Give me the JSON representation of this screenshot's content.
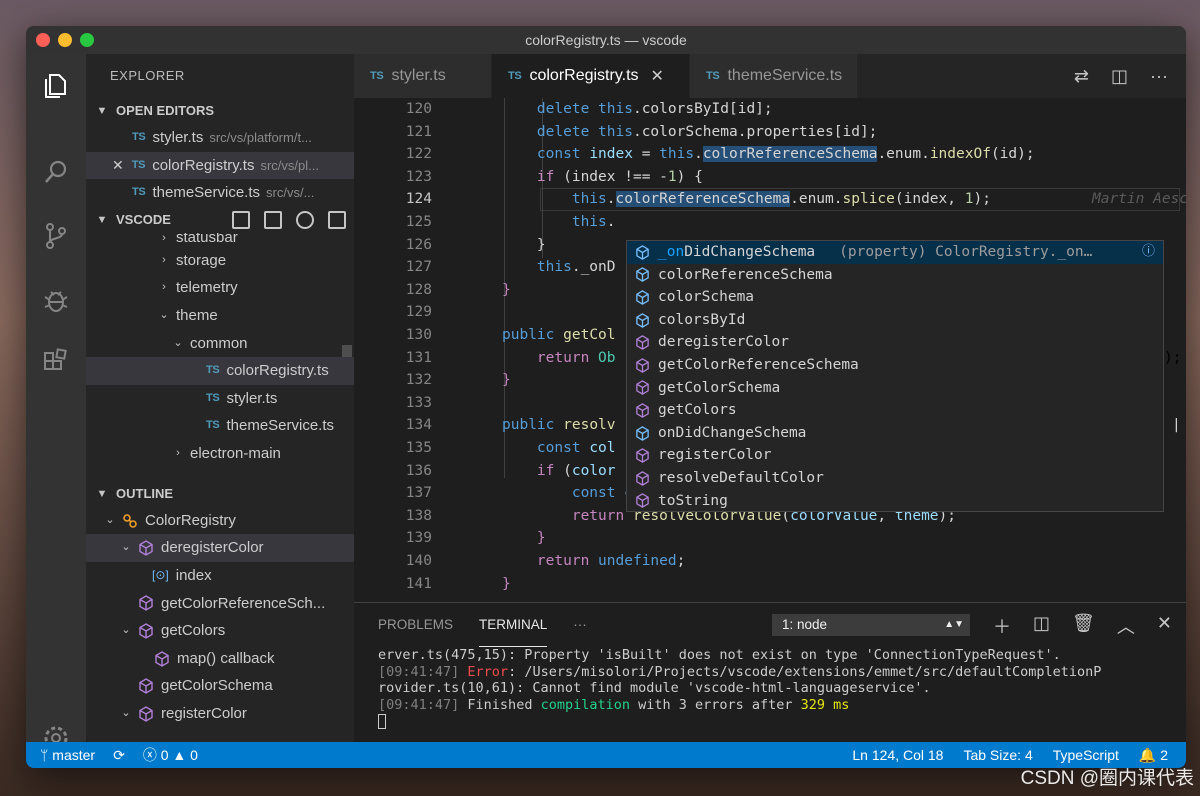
{
  "window": {
    "title": "colorRegistry.ts — vscode"
  },
  "explorer": {
    "title": "EXPLORER",
    "open_editors": {
      "label": "OPEN EDITORS",
      "items": [
        {
          "name": "styler.ts",
          "path": "src/vs/platform/t..."
        },
        {
          "name": "colorRegistry.ts",
          "path": "src/vs/pl..."
        },
        {
          "name": "themeService.ts",
          "path": "src/vs/..."
        }
      ]
    },
    "workspace": {
      "label": "VSCODE",
      "items": [
        "statusbar",
        "storage",
        "telemetry",
        "theme",
        "common",
        "colorRegistry.ts",
        "styler.ts",
        "themeService.ts",
        "electron-main"
      ]
    },
    "outline": {
      "label": "OUTLINE",
      "items": [
        "ColorRegistry",
        "deregisterColor",
        "index",
        "getColorReferenceSch...",
        "getColors",
        "map() callback",
        "getColorSchema",
        "registerColor"
      ]
    }
  },
  "tabs": [
    {
      "label": "styler.ts"
    },
    {
      "label": "colorRegistry.ts"
    },
    {
      "label": "themeService.ts"
    }
  ],
  "tab_badge": "TS",
  "editor": {
    "line_numbers": [
      "120",
      "121",
      "122",
      "123",
      "124",
      "125",
      "126",
      "127",
      "128",
      "129",
      "130",
      "131",
      "132",
      "133",
      "134",
      "135",
      "136",
      "137",
      "138",
      "139",
      "140",
      "141"
    ],
    "blame": "Martin Aesc",
    "tail_131": ");",
    "tail_134": "| un"
  },
  "suggest": {
    "detail": "(property) ColorRegistry._on…",
    "items": [
      {
        "match": "_on",
        "rest": "DidChangeSchema"
      },
      {
        "match": "",
        "rest": "colorReferenceSchema"
      },
      {
        "match": "",
        "rest": "colorSchema"
      },
      {
        "match": "",
        "rest": "colorsById"
      },
      {
        "match": "",
        "rest": "deregisterColor"
      },
      {
        "match": "",
        "rest": "getColorReferenceSchema"
      },
      {
        "match": "",
        "rest": "getColorSchema"
      },
      {
        "match": "",
        "rest": "getColors"
      },
      {
        "match": "",
        "rest": "onDidChangeSchema"
      },
      {
        "match": "",
        "rest": "registerColor"
      },
      {
        "match": "",
        "rest": "resolveDefaultColor"
      },
      {
        "match": "",
        "rest": "toString"
      }
    ]
  },
  "panel": {
    "tabs": [
      "PROBLEMS",
      "TERMINAL",
      "···"
    ],
    "terminal_select": "1: node",
    "lines": [
      "erver.ts(475,15): Property 'isBuilt' does not exist on type 'ConnectionTypeRequest'.",
      "/Users/misolori/Projects/vscode/extensions/emmet/src/defaultCompletionP",
      "rovider.ts(10,61): Cannot find module 'vscode-html-languageservice'.",
      "Finished ",
      "compilation",
      " with 3 errors after ",
      "329 ms"
    ],
    "timestamp": "[09:41:47]",
    "error_label": "Error"
  },
  "status": {
    "branch": "master",
    "errors": "0",
    "warnings": "0",
    "position": "Ln 124, Col 18",
    "tab_size": "Tab Size: 4",
    "language": "TypeScript",
    "notifications": "2"
  },
  "watermark": "CSDN @圈内课代表",
  "colors": {
    "accent": "#007acc",
    "ts_icon": "#519aba",
    "cube": "#b180d7",
    "selection": "#062f4a"
  }
}
